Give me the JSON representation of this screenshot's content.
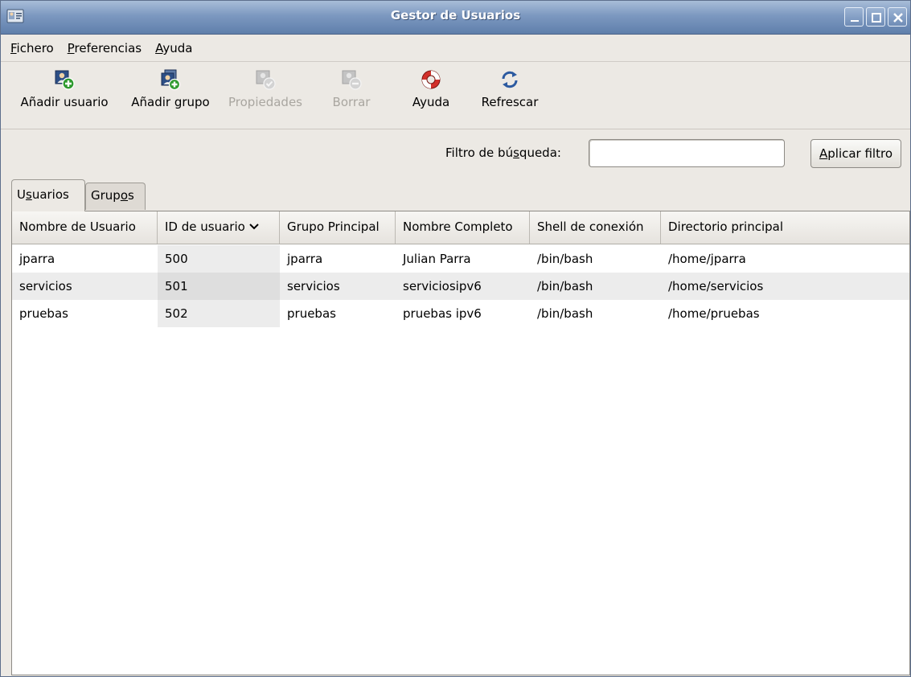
{
  "window": {
    "title": "Gestor de Usuarios"
  },
  "menubar": {
    "items": [
      {
        "mnemonic": "F",
        "rest": "ichero"
      },
      {
        "mnemonic": "P",
        "rest": "referencias"
      },
      {
        "mnemonic": "A",
        "rest": "yuda"
      }
    ]
  },
  "toolbar": {
    "add_user": "Añadir usuario",
    "add_group": "Añadir grupo",
    "properties": "Propiedades",
    "delete": "Borrar",
    "help": "Ayuda",
    "refresh": "Refrescar"
  },
  "filter": {
    "label_pre": "Filtro de bú",
    "label_mn": "s",
    "label_post": "queda:",
    "value": "",
    "button_mn": "A",
    "button_rest": "plicar filtro"
  },
  "tabs": [
    {
      "pre": "U",
      "mn": "s",
      "post": "uarios",
      "active": true
    },
    {
      "pre": "Grup",
      "mn": "o",
      "post": "s",
      "active": false
    }
  ],
  "table": {
    "columns": [
      "Nombre de Usuario",
      "ID de usuario",
      "Grupo Principal",
      "Nombre Completo",
      "Shell de conexión",
      "Directorio principal"
    ],
    "sort_icon": "chevron-down-icon",
    "rows": [
      [
        "jparra",
        "500",
        "jparra",
        "Julian Parra",
        "/bin/bash",
        "/home/jparra"
      ],
      [
        "servicios",
        "501",
        "servicios",
        "serviciosipv6",
        "/bin/bash",
        "/home/servicios"
      ],
      [
        "pruebas",
        "502",
        "pruebas",
        "pruebas ipv6",
        "/bin/bash",
        "/home/pruebas"
      ]
    ]
  }
}
